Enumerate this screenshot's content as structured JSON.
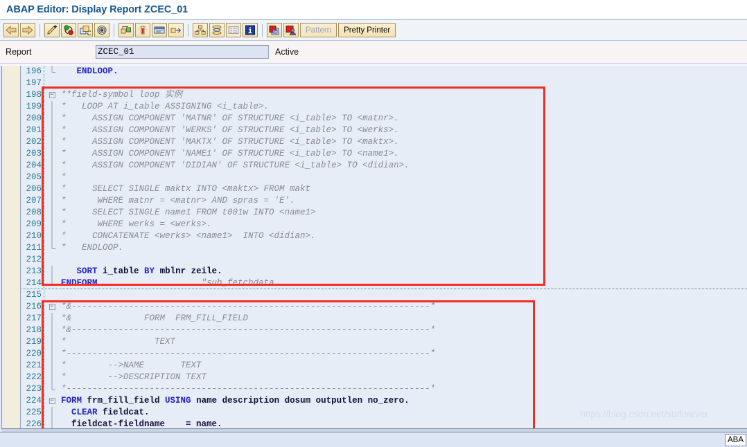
{
  "window": {
    "title": "ABAP Editor: Display Report ZCEC_01"
  },
  "toolbar": {
    "icons": [
      {
        "name": "back-arrow-icon",
        "glyph": "back"
      },
      {
        "name": "forward-arrow-icon",
        "glyph": "forward"
      },
      {
        "name": "change-editor-icon",
        "glyph": "pencil"
      },
      {
        "name": "activate-icon",
        "glyph": "activate"
      },
      {
        "name": "other-object-icon",
        "glyph": "copyobj"
      },
      {
        "name": "display-object-list-icon",
        "glyph": "spiral"
      },
      {
        "name": "check-icon",
        "glyph": "checkobj"
      },
      {
        "name": "breakpoint-icon",
        "glyph": "thermo"
      },
      {
        "name": "debugging-icon",
        "glyph": "debug"
      },
      {
        "name": "activate-navigation-icon",
        "glyph": "navigate"
      },
      {
        "name": "object-hierarchy-icon",
        "glyph": "hierarchy"
      },
      {
        "name": "stack-icon",
        "glyph": "stack"
      },
      {
        "name": "list-icon",
        "glyph": "list"
      },
      {
        "name": "info-icon",
        "glyph": "info"
      },
      {
        "name": "where-used-icon",
        "glyph": "whereused"
      },
      {
        "name": "user-object-icon",
        "glyph": "userobj"
      }
    ],
    "pattern_label": "Pattern",
    "pretty_printer_label": "Pretty Printer"
  },
  "report_row": {
    "label": "Report",
    "value": "ZCEC_01",
    "placeholder": "",
    "status": "Active"
  },
  "editor": {
    "lines": [
      {
        "num": "196",
        "fold": "end",
        "code": [
          {
            "t": "   ",
            "c": "nrm"
          },
          {
            "t": "ENDLOOP.",
            "c": "kw"
          }
        ]
      },
      {
        "num": "197",
        "fold": "none",
        "code": []
      },
      {
        "num": "198",
        "fold": "start",
        "code": [
          {
            "t": "**field-symbol loop 实例",
            "c": "cmt"
          }
        ]
      },
      {
        "num": "199",
        "fold": "bar",
        "code": [
          {
            "t": "*   LOOP AT i_table ASSIGNING <i_table>.",
            "c": "cmt"
          }
        ]
      },
      {
        "num": "200",
        "fold": "bar",
        "code": [
          {
            "t": "*     ASSIGN COMPONENT 'MATNR' OF STRUCTURE <i_table> TO <matnr>.",
            "c": "cmt"
          }
        ]
      },
      {
        "num": "201",
        "fold": "bar",
        "code": [
          {
            "t": "*     ASSIGN COMPONENT 'WERKS' OF STRUCTURE <i_table> TO <werks>.",
            "c": "cmt"
          }
        ]
      },
      {
        "num": "202",
        "fold": "bar",
        "code": [
          {
            "t": "*     ASSIGN COMPONENT 'MAKTX' OF STRUCTURE <i_table> TO <maktx>.",
            "c": "cmt"
          }
        ]
      },
      {
        "num": "203",
        "fold": "bar",
        "code": [
          {
            "t": "*     ASSIGN COMPONENT 'NAME1' OF STRUCTURE <i_table> TO <name1>.",
            "c": "cmt"
          }
        ]
      },
      {
        "num": "204",
        "fold": "bar",
        "code": [
          {
            "t": "*     ASSIGN COMPONENT 'DIDIAN' OF STRUCTURE <i_table> TO <didian>.",
            "c": "cmt"
          }
        ]
      },
      {
        "num": "205",
        "fold": "bar",
        "code": [
          {
            "t": "*",
            "c": "cmt"
          }
        ]
      },
      {
        "num": "206",
        "fold": "bar",
        "code": [
          {
            "t": "*     SELECT SINGLE maktx INTO <maktx> FROM makt",
            "c": "cmt"
          }
        ]
      },
      {
        "num": "207",
        "fold": "bar",
        "code": [
          {
            "t": "*      WHERE matnr = <matnr> AND spras = 'E'.",
            "c": "cmt"
          }
        ]
      },
      {
        "num": "208",
        "fold": "bar",
        "code": [
          {
            "t": "*     SELECT SINGLE name1 FROM t001w INTO <name1>",
            "c": "cmt"
          }
        ]
      },
      {
        "num": "209",
        "fold": "bar",
        "code": [
          {
            "t": "*      WHERE werks = <werks>.",
            "c": "cmt"
          }
        ]
      },
      {
        "num": "210",
        "fold": "bar",
        "code": [
          {
            "t": "*     CONCATENATE <werks> <name1>  INTO <didian>.",
            "c": "cmt"
          }
        ]
      },
      {
        "num": "211",
        "fold": "end",
        "code": [
          {
            "t": "*   ENDLOOP.",
            "c": "cmt"
          }
        ]
      },
      {
        "num": "212",
        "fold": "none",
        "code": []
      },
      {
        "num": "213",
        "fold": "bar",
        "code": [
          {
            "t": "   ",
            "c": "nrm"
          },
          {
            "t": "SORT",
            "c": "kw"
          },
          {
            "t": " i_table ",
            "c": "nrm"
          },
          {
            "t": "BY",
            "c": "kw"
          },
          {
            "t": " mblnr zeile.",
            "c": "nrm"
          }
        ]
      },
      {
        "num": "214",
        "fold": "end",
        "code": [
          {
            "t": "ENDFORM.",
            "c": "kw"
          },
          {
            "t": "                   ",
            "c": "nrm"
          },
          {
            "t": "\"sub_fetchdata",
            "c": "cmt"
          }
        ],
        "sep": true
      },
      {
        "num": "215",
        "fold": "none",
        "code": []
      },
      {
        "num": "216",
        "fold": "start",
        "code": [
          {
            "t": "*&---------------------------------------------------------------------*",
            "c": "cmt"
          }
        ]
      },
      {
        "num": "217",
        "fold": "bar",
        "code": [
          {
            "t": "*&              FORM  FRM_FILL_FIELD",
            "c": "cmt"
          }
        ]
      },
      {
        "num": "218",
        "fold": "bar",
        "code": [
          {
            "t": "*&---------------------------------------------------------------------*",
            "c": "cmt"
          }
        ]
      },
      {
        "num": "219",
        "fold": "bar",
        "code": [
          {
            "t": "*                 TEXT",
            "c": "cmt"
          }
        ]
      },
      {
        "num": "220",
        "fold": "bar",
        "code": [
          {
            "t": "*----------------------------------------------------------------------*",
            "c": "cmt"
          }
        ]
      },
      {
        "num": "221",
        "fold": "bar",
        "code": [
          {
            "t": "*        -->NAME       TEXT",
            "c": "cmt"
          }
        ]
      },
      {
        "num": "222",
        "fold": "bar",
        "code": [
          {
            "t": "*        -->DESCRIPTION TEXT",
            "c": "cmt"
          }
        ]
      },
      {
        "num": "223",
        "fold": "end",
        "code": [
          {
            "t": "*----------------------------------------------------------------------*",
            "c": "cmt"
          }
        ]
      },
      {
        "num": "224",
        "fold": "start",
        "code": [
          {
            "t": "FORM",
            "c": "kw"
          },
          {
            "t": " frm_fill_field ",
            "c": "nrm"
          },
          {
            "t": "USING",
            "c": "kw"
          },
          {
            "t": " name description dosum outputlen no_zero.",
            "c": "nrm"
          }
        ]
      },
      {
        "num": "225",
        "fold": "bar",
        "code": [
          {
            "t": "  ",
            "c": "nrm"
          },
          {
            "t": "CLEAR",
            "c": "kw"
          },
          {
            "t": " fieldcat.",
            "c": "nrm"
          }
        ]
      },
      {
        "num": "226",
        "fold": "bar",
        "code": [
          {
            "t": "  fieldcat-fieldname    = name.",
            "c": "nrm"
          }
        ]
      }
    ]
  },
  "annotations": {
    "box1_name": "highlight-box-field-symbol-block",
    "box2_name": "highlight-box-form-frm-fill-field"
  },
  "watermark": {
    "text": "https://blog.csdn.net/staforever"
  },
  "bottom": {
    "status_tab": "ABA"
  },
  "colors": {
    "title": "#15578C",
    "keyword": "#2222CC",
    "comment": "#8A8A92",
    "linenumber": "#2B7C8C",
    "editor_bg": "#E7EDF7",
    "margin": "#F2EDDC",
    "highlight": "#F52A20",
    "toolbar_button": "#F3E2B4"
  }
}
